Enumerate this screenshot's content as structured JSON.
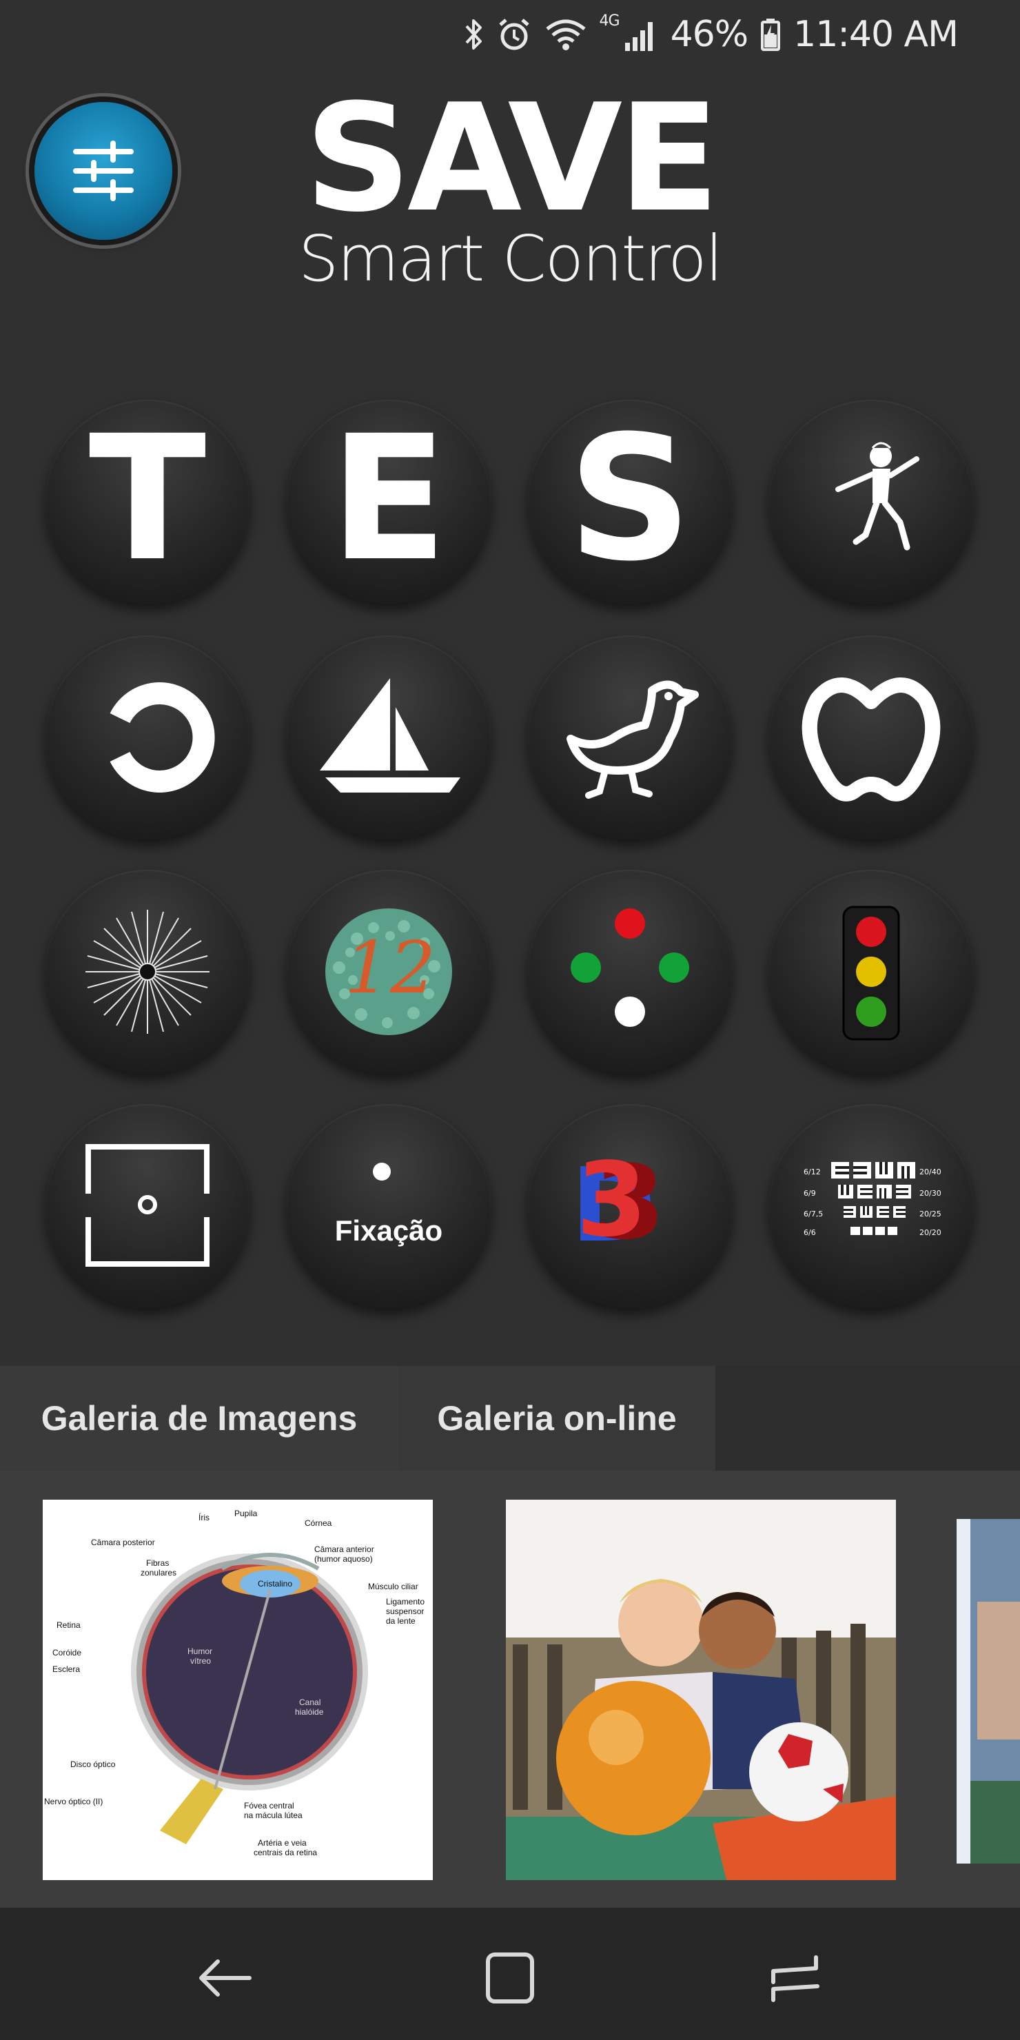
{
  "status_bar": {
    "signal_badge": "4G",
    "battery": "46%",
    "time": "11:40 AM",
    "icons": [
      "bluetooth-icon",
      "alarm-icon",
      "wifi-icon",
      "cell-signal-icon",
      "battery-icon"
    ]
  },
  "header": {
    "title": "SAVE",
    "subtitle": "Smart Control",
    "settings_icon": "sliders-icon"
  },
  "grid": {
    "tiles": [
      {
        "id": "letter-t",
        "label": "T"
      },
      {
        "id": "letter-e",
        "label": "E"
      },
      {
        "id": "letter-s",
        "label": "S"
      },
      {
        "id": "child-figure",
        "icon": "child-icon"
      },
      {
        "id": "landolt-c",
        "icon": "landolt-c-icon"
      },
      {
        "id": "sailboat",
        "icon": "sailboat-icon"
      },
      {
        "id": "duck",
        "icon": "duck-icon"
      },
      {
        "id": "apple",
        "icon": "apple-icon"
      },
      {
        "id": "astigmatism-dial",
        "icon": "radial-lines-icon"
      },
      {
        "id": "ishihara",
        "label": "12"
      },
      {
        "id": "worth-four-dot",
        "icon": "four-dots-icon"
      },
      {
        "id": "traffic-light",
        "icon": "traffic-light-icon"
      },
      {
        "id": "frame-target",
        "icon": "frame-target-icon"
      },
      {
        "id": "fixation",
        "label": "Fixação"
      },
      {
        "id": "three-d",
        "label": "3D"
      },
      {
        "id": "acuity-chart",
        "label_rows": [
          [
            "6/12",
            "20/40"
          ],
          [
            "6/9",
            "20/30"
          ],
          [
            "6/7,5",
            "20/25"
          ],
          [
            "6/6",
            "20/20"
          ]
        ]
      }
    ]
  },
  "gallery": {
    "tabs": [
      "Galeria de Imagens",
      "Galeria on-line"
    ],
    "eye_labels": {
      "iris": "Íris",
      "pupila": "Pupila",
      "cornea": "Córnea",
      "camara_posterior": "Câmara posterior",
      "camara_anterior": "Câmara anterior",
      "humor_aquoso": "(humor aquoso)",
      "fibras": "Fibras",
      "zonulares": "zonulares",
      "musculo": "Músculo ciliar",
      "ligamento": "Ligamento",
      "suspensor": "suspensor",
      "da_lente": "da lente",
      "retina": "Retina",
      "coroide": "Coróide",
      "esclera": "Esclera",
      "humor_vitreo_1": "Humor",
      "humor_vitreo_2": "vítreo",
      "cristalino": "Cristalino",
      "canal_1": "Canal",
      "canal_2": "hialóide",
      "disco": "Disco óptico",
      "nervo": "Nervo óptico (II)",
      "fovea_1": "Fóvea central",
      "fovea_2": "na mácula lútea",
      "arteria_1": "Artéria e veia",
      "arteria_2": "centrais da retina"
    }
  },
  "nav": {
    "icons": [
      "back-icon",
      "home-icon",
      "recents-icon"
    ]
  },
  "colors": {
    "background": "#303030",
    "tile": "#262626",
    "accent_blue": "#137aa8",
    "gallery_bg": "#3d3d3d",
    "nav_bg": "#262626"
  }
}
